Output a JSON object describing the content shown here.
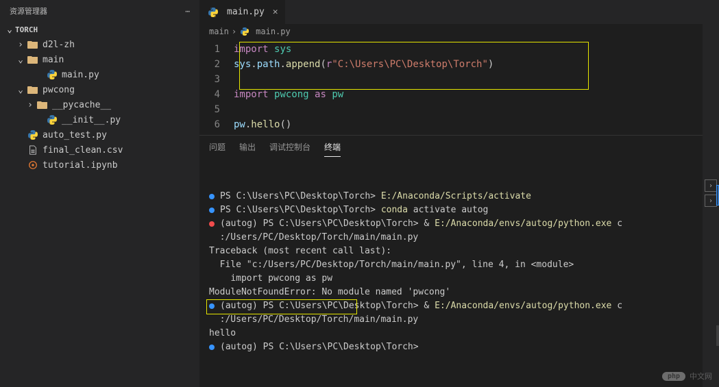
{
  "sidebar": {
    "title": "资源管理器",
    "workspace": "TORCH",
    "tree": [
      {
        "depth": 1,
        "chev": "›",
        "icon": "folder",
        "label": "d2l-zh"
      },
      {
        "depth": 1,
        "chev": "⌄",
        "icon": "folder",
        "label": "main"
      },
      {
        "depth": 3,
        "chev": "",
        "icon": "py",
        "label": "main.py"
      },
      {
        "depth": 1,
        "chev": "⌄",
        "icon": "folder",
        "label": "pwcong"
      },
      {
        "depth": 2,
        "chev": "›",
        "icon": "folder",
        "label": "__pycache__"
      },
      {
        "depth": 3,
        "chev": "",
        "icon": "py",
        "label": "__init__.py"
      },
      {
        "depth": 1,
        "chev": "",
        "icon": "py",
        "label": "auto_test.py"
      },
      {
        "depth": 1,
        "chev": "",
        "icon": "csv",
        "label": "final_clean.csv"
      },
      {
        "depth": 1,
        "chev": "",
        "icon": "nb",
        "label": "tutorial.ipynb"
      }
    ]
  },
  "tab": {
    "label": "main.py",
    "icon": "py"
  },
  "breadcrumb": {
    "first": "main",
    "second": "main.py"
  },
  "code": {
    "lines": [
      {
        "n": "1",
        "html": "<span class='kw'>import</span> <span class='mod'>sys</span>"
      },
      {
        "n": "2",
        "html": "<span class='obj'>sys</span>.<span class='obj'>path</span>.<span class='fn'>append</span>(<span class='kw'>r</span><span class='str'>\"C:\\Users\\PC\\Desktop\\Torch\"</span>)"
      },
      {
        "n": "3",
        "html": ""
      },
      {
        "n": "4",
        "html": "<span class='kw'>import</span> <span class='mod'>pwcong</span> <span class='kw'>as</span> <span class='mod'>pw</span>"
      },
      {
        "n": "5",
        "html": ""
      },
      {
        "n": "6",
        "html": "<span class='obj'>pw</span>.<span class='fn'>hello</span>()"
      }
    ]
  },
  "panel": {
    "tabs": [
      {
        "label": "问题",
        "active": false
      },
      {
        "label": "输出",
        "active": false
      },
      {
        "label": "调试控制台",
        "active": false
      },
      {
        "label": "终端",
        "active": true
      }
    ],
    "terminal_lines": [
      {
        "kind": "blue",
        "ps": "PS C:\\Users\\PC\\Desktop\\Torch> ",
        "cmd_yellow": "E:/Anaconda/Scripts/activate"
      },
      {
        "kind": "blue",
        "ps": "PS C:\\Users\\PC\\Desktop\\Torch> ",
        "cmd_yellow": "conda ",
        "rest": "activate autog"
      },
      {
        "kind": "red",
        "ps": "(autog) PS C:\\Users\\PC\\Desktop\\Torch> ",
        "rest_pre": "& ",
        "cmd_yellow": "E:/Anaconda/envs/autog/python.exe ",
        "rest": "c"
      },
      {
        "cont": ":/Users/PC/Desktop/Torch/main/main.py"
      },
      {
        "plain": "Traceback (most recent call last):"
      },
      {
        "plain": "  File \"c:/Users/PC/Desktop/Torch/main/main.py\", line 4, in <module>"
      },
      {
        "plain": "    import pwcong as pw"
      },
      {
        "plain": "ModuleNotFoundError: No module named 'pwcong'"
      },
      {
        "kind": "blue",
        "ps": "(autog) PS C:\\Users\\PC\\Desktop\\Torch> ",
        "rest_pre": "& ",
        "cmd_yellow": "E:/Anaconda/envs/autog/python.exe ",
        "rest": "c"
      },
      {
        "cont": ":/Users/PC/Desktop/Torch/main/main.py"
      },
      {
        "plain": "hello"
      },
      {
        "kind": "blue",
        "ps": "(autog) PS C:\\Users\\PC\\Desktop\\Torch> "
      }
    ]
  },
  "watermark": {
    "badge": "php",
    "text": "中文网"
  }
}
